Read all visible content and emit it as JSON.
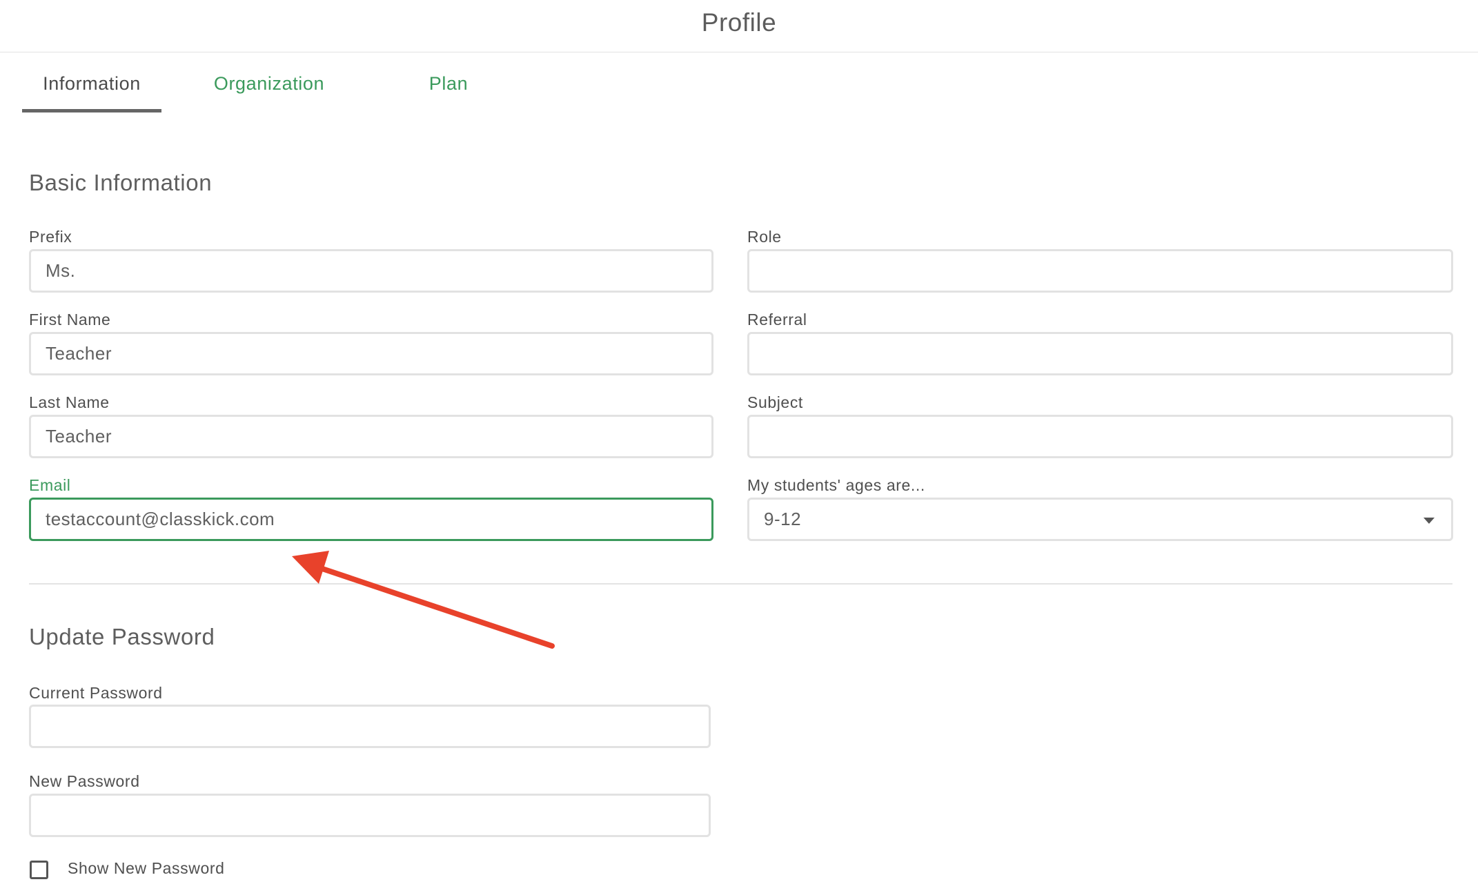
{
  "header": {
    "title": "Profile"
  },
  "tabs": [
    {
      "label": "Information",
      "active": true
    },
    {
      "label": "Organization",
      "active": false
    },
    {
      "label": "Plan",
      "active": false
    }
  ],
  "basic_info": {
    "title": "Basic Information",
    "prefix": {
      "label": "Prefix",
      "value": "Ms."
    },
    "first_name": {
      "label": "First Name",
      "value": "Teacher"
    },
    "last_name": {
      "label": "Last Name",
      "value": "Teacher"
    },
    "email": {
      "label": "Email",
      "value": "testaccount@classkick.com",
      "focused": true
    },
    "role": {
      "label": "Role",
      "value": ""
    },
    "referral": {
      "label": "Referral",
      "value": ""
    },
    "subject": {
      "label": "Subject",
      "value": ""
    },
    "ages": {
      "label": "My students' ages are...",
      "value": "9-12"
    }
  },
  "update_password": {
    "title": "Update Password",
    "current_password": {
      "label": "Current Password",
      "value": ""
    },
    "new_password": {
      "label": "New Password",
      "value": ""
    },
    "show_new_password": {
      "label": "Show New Password",
      "checked": false
    }
  },
  "annotation": {
    "type": "arrow",
    "color": "#e8422b",
    "target": "email-field"
  },
  "colors": {
    "accent": "#3b9a5c",
    "arrow": "#e8422b",
    "field_border": "#e2e2e2",
    "text": "#555555"
  },
  "icons": {
    "select_caret": "caret-down-icon",
    "checkbox": "checkbox-unchecked"
  }
}
